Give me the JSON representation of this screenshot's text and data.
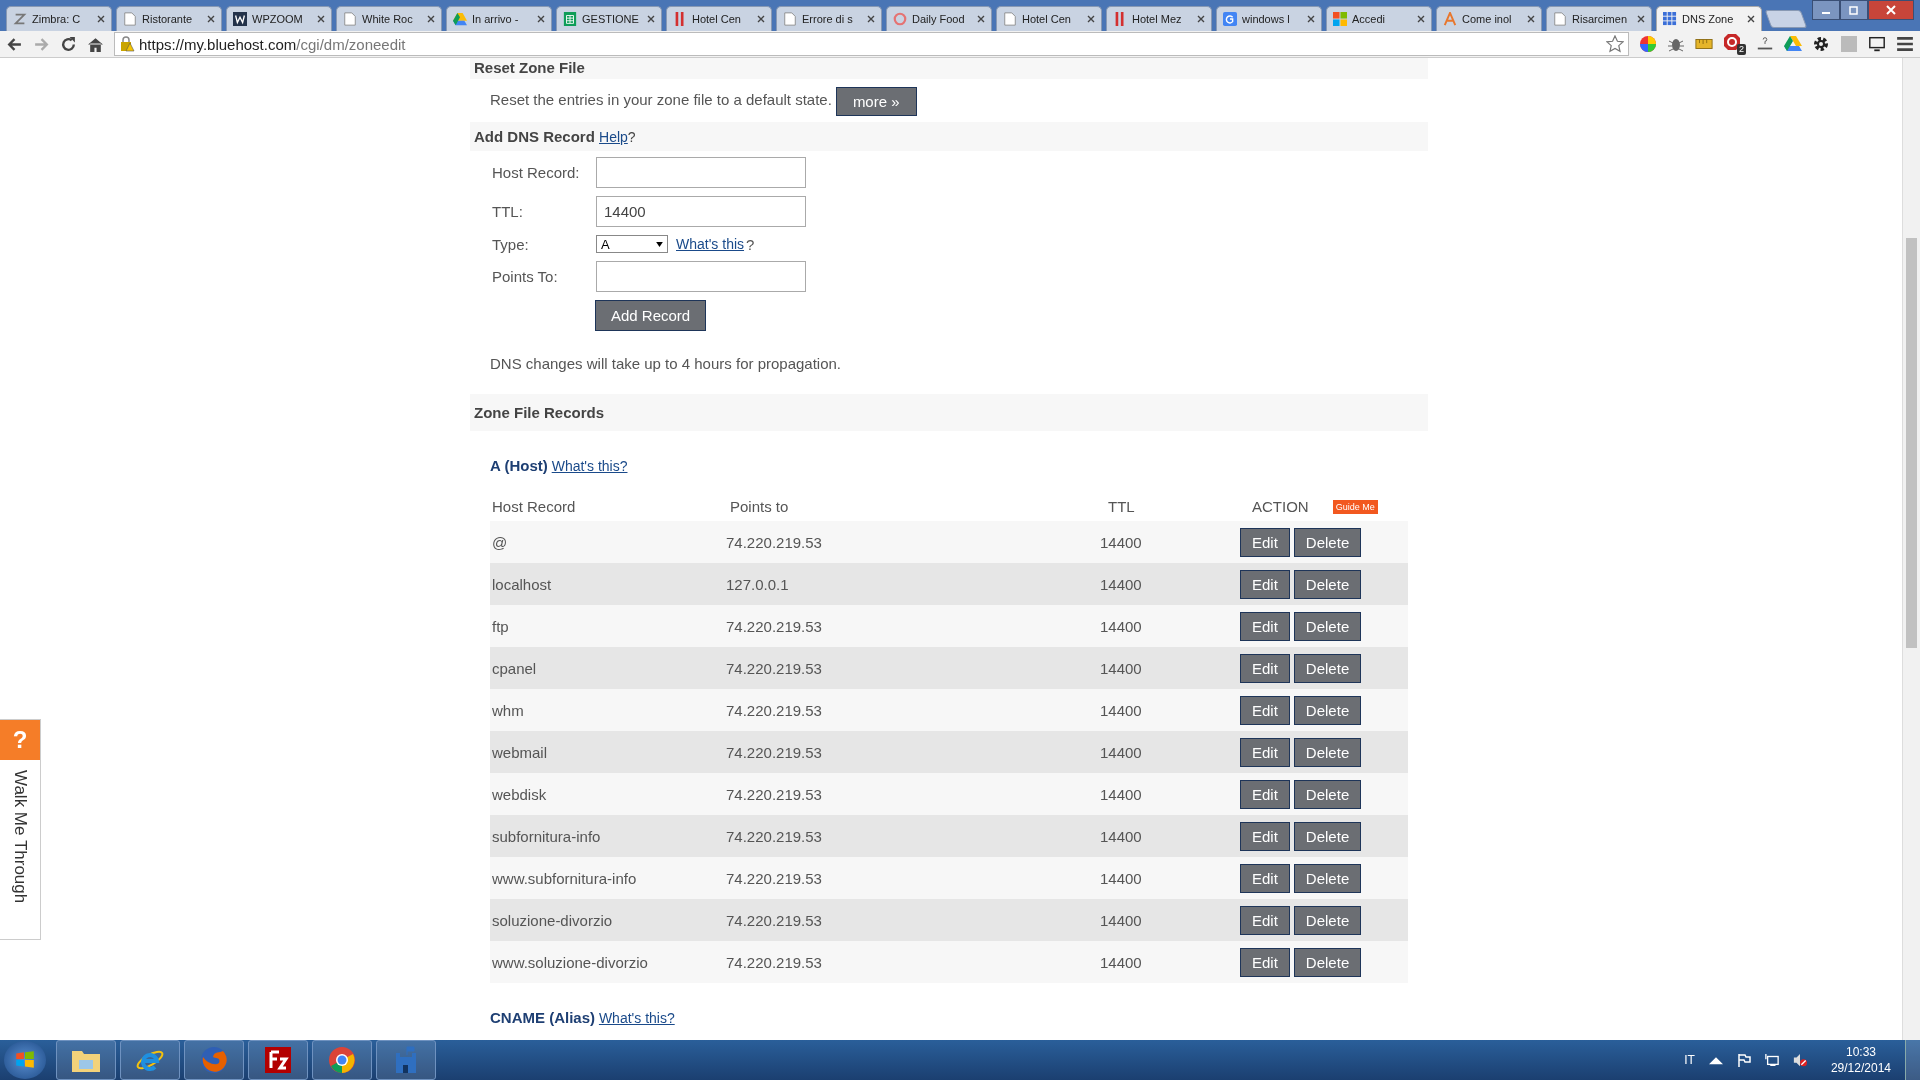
{
  "browser": {
    "tabs": [
      {
        "label": "Zimbra: C",
        "selected": false
      },
      {
        "label": "Ristorante",
        "selected": false
      },
      {
        "label": "WPZOOM",
        "selected": false
      },
      {
        "label": "White Roc",
        "selected": false
      },
      {
        "label": "In arrivo -",
        "selected": false
      },
      {
        "label": "GESTIONE",
        "selected": false
      },
      {
        "label": "Hotel Cen",
        "selected": false
      },
      {
        "label": "Errore di s",
        "selected": false
      },
      {
        "label": "Daily Food",
        "selected": false
      },
      {
        "label": "Hotel Cen",
        "selected": false
      },
      {
        "label": "Hotel Mez",
        "selected": false
      },
      {
        "label": "windows l",
        "selected": false
      },
      {
        "label": "Accedi",
        "selected": false
      },
      {
        "label": "Come inol",
        "selected": false
      },
      {
        "label": "Risarcimen",
        "selected": false
      },
      {
        "label": "DNS Zone",
        "selected": true
      }
    ],
    "url_host": "https://my.bluehost.com",
    "url_path": "/cgi/dm/zoneedit",
    "extension_badge": "2"
  },
  "reset": {
    "heading": "Reset Zone File",
    "text": "Reset the entries in your zone file to a default state.",
    "button": "more »"
  },
  "add": {
    "heading": "Add DNS Record",
    "help": "Help",
    "help_suffix": "?",
    "fields": [
      {
        "label": "Host Record:",
        "kind": "text"
      },
      {
        "label": "TTL:",
        "kind": "text",
        "value": "14400"
      },
      {
        "label": "Type:",
        "kind": "select",
        "value": "A",
        "link": "What's this",
        "suffix": "?"
      },
      {
        "label": "Points To:",
        "kind": "text"
      }
    ],
    "button": "Add Record",
    "note": "DNS changes will take up to 4 hours for propagation."
  },
  "zone": {
    "heading": "Zone File Records",
    "section": "A (Host)",
    "section_link": "What's this?",
    "columns": [
      "Host Record",
      "Points to",
      "TTL",
      "ACTION"
    ],
    "guide": "Guide Me",
    "rows": [
      {
        "host": "@",
        "points_to": "74.220.219.53",
        "ttl": "14400",
        "edit": "Edit",
        "delete": "Delete"
      },
      {
        "host": "localhost",
        "points_to": "127.0.0.1",
        "ttl": "14400",
        "edit": "Edit",
        "delete": "Delete"
      },
      {
        "host": "ftp",
        "points_to": "74.220.219.53",
        "ttl": "14400",
        "edit": "Edit",
        "delete": "Delete"
      },
      {
        "host": "cpanel",
        "points_to": "74.220.219.53",
        "ttl": "14400",
        "edit": "Edit",
        "delete": "Delete"
      },
      {
        "host": "whm",
        "points_to": "74.220.219.53",
        "ttl": "14400",
        "edit": "Edit",
        "delete": "Delete"
      },
      {
        "host": "webmail",
        "points_to": "74.220.219.53",
        "ttl": "14400",
        "edit": "Edit",
        "delete": "Delete"
      },
      {
        "host": "webdisk",
        "points_to": "74.220.219.53",
        "ttl": "14400",
        "edit": "Edit",
        "delete": "Delete"
      },
      {
        "host": "subfornitura-info",
        "points_to": "74.220.219.53",
        "ttl": "14400",
        "edit": "Edit",
        "delete": "Delete"
      },
      {
        "host": "www.subfornitura-info",
        "points_to": "74.220.219.53",
        "ttl": "14400",
        "edit": "Edit",
        "delete": "Delete"
      },
      {
        "host": "soluzione-divorzio",
        "points_to": "74.220.219.53",
        "ttl": "14400",
        "edit": "Edit",
        "delete": "Delete"
      },
      {
        "host": "www.soluzione-divorzio",
        "points_to": "74.220.219.53",
        "ttl": "14400",
        "edit": "Edit",
        "delete": "Delete"
      }
    ],
    "next_section": "CNAME (Alias)",
    "next_link": "What's this?"
  },
  "walkme": {
    "icon_text": "?",
    "label": "Walk Me Through"
  },
  "taskbar": {
    "language": "IT",
    "time": "10:33",
    "date": "29/12/2014"
  }
}
